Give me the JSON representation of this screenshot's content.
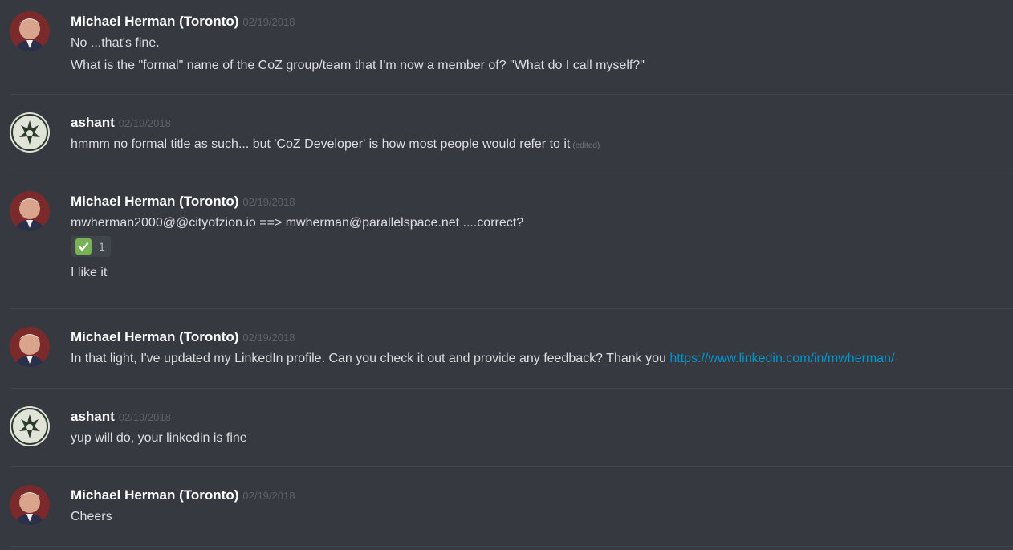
{
  "messages": [
    {
      "author": "Michael Herman (Toronto)",
      "timestamp": "02/19/2018",
      "lines": [
        "No ...that's fine.",
        "What is the \"formal\" name of the CoZ group/team that I'm now a member of?  \"What do I call myself?\""
      ]
    },
    {
      "author": "ashant",
      "timestamp": "02/19/2018",
      "lines": [
        "hmmm no formal title as such... but 'CoZ Developer' is how most people would refer to it"
      ],
      "edited_label": "(edited)"
    },
    {
      "author": "Michael Herman (Toronto)",
      "timestamp": "02/19/2018",
      "lines": [
        "mwherman2000@@cityofzion.io ==> mwherman@parallelspace.net ....correct?"
      ],
      "reaction": {
        "emoji": "white-check-mark",
        "count": "1"
      },
      "lines_after_reaction": [
        "I like it"
      ]
    },
    {
      "author": "Michael Herman (Toronto)",
      "timestamp": "02/19/2018",
      "lines": [
        "In that light, I've updated my LinkedIn profile.  Can you check it out and provide any feedback?  Thank you "
      ],
      "link": "https://www.linkedin.com/in/mwherman/"
    },
    {
      "author": "ashant",
      "timestamp": "02/19/2018",
      "lines": [
        "yup will do, your linkedin is fine"
      ]
    },
    {
      "author": "Michael Herman (Toronto)",
      "timestamp": "02/19/2018",
      "lines": [
        "Cheers"
      ]
    }
  ],
  "colors": {
    "background": "#36393f",
    "username": "#ffffff",
    "text": "#dcddde",
    "timestamp": "#5d6168",
    "link": "#0096cf",
    "reaction_bg": "#40444b",
    "check_green": "#77b255"
  },
  "icons": {
    "michael_avatar": "avatar-icon",
    "ashant_avatar": "avatar-icon",
    "reaction_emoji": "white-check-mark-icon"
  }
}
